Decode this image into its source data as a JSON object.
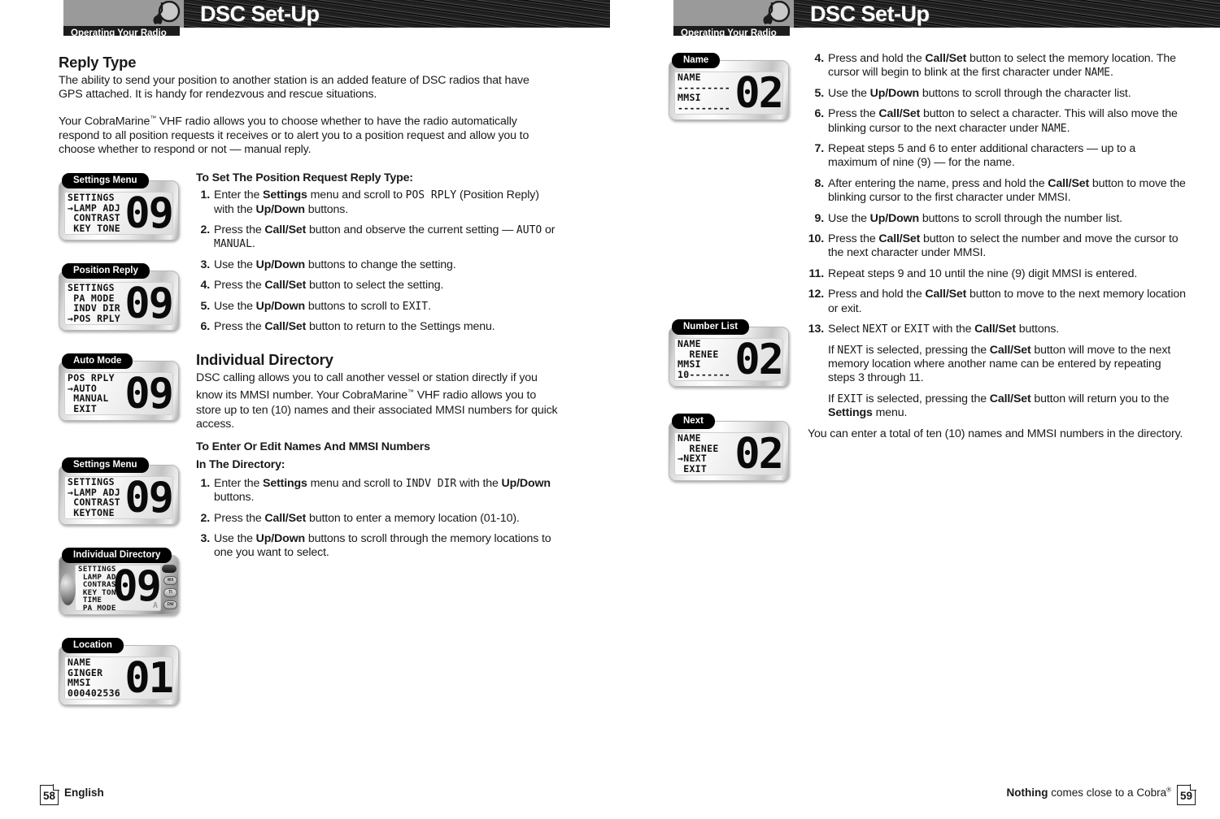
{
  "header": {
    "title": "DSC Set-Up",
    "tab": "Operating Your Radio",
    "mic_icon": "radio-mic-icon"
  },
  "left_page": {
    "section_title": "Reply Type",
    "para1": "The ability to send your position to another station is an added feature of DSC radios that have GPS attached. It is handy for rendezvous and rescue situations.",
    "para2_a": "Your CobraMarine",
    "para2_tm": "™",
    "para2_b": " VHF radio allows you to choose whether to have the radio automatically respond to all position requests it receives or to alert you to a position request and allow you to choose whether to respond or not — manual reply.",
    "proc1_title": "To Set The Position Request Reply Type:",
    "proc1_steps": [
      {
        "num": "1.",
        "html": "Enter the <b>Settings</b> menu and scroll to <span class=\"lcdtxt\">POS RPLY</span> (Position Reply) with the <b>Up/Down</b> buttons."
      },
      {
        "num": "2.",
        "html": "Press the <b>Call/Set</b> button and observe the current setting — <span class=\"lcdtxt\">AUTO</span> or <span class=\"lcdtxt\">MANUAL</span>."
      },
      {
        "num": "3.",
        "html": "Use the <b>Up/Down</b> buttons to change the setting."
      },
      {
        "num": "4.",
        "html": "Press the <b>Call/Set</b> button to select the setting."
      },
      {
        "num": "5.",
        "html": "Use the <b>Up/Down</b> buttons to scroll to <span class=\"lcdtxt\">EXIT</span>."
      },
      {
        "num": "6.",
        "html": "Press the <b>Call/Set</b> button to return to the Settings menu."
      }
    ],
    "section2_title": "Individual Directory",
    "para3_a": "DSC calling allows you to call another vessel or station directly if you know its MMSI number. Your CobraMarine",
    "para3_tm": "™",
    "para3_b": " VHF radio allows you to store up to ten (10) names and their associated MMSI numbers for quick access.",
    "proc2_title_l1": "To Enter Or Edit Names And MMSI Numbers",
    "proc2_title_l2": "In The Directory:",
    "proc2_steps": [
      {
        "num": "1.",
        "html": "Enter the <b>Settings</b> menu and scroll to <span class=\"lcdtxt\">INDV DIR</span> with the <b>Up/Down</b> buttons."
      },
      {
        "num": "2.",
        "html": "Press the <b>Call/Set</b> button to enter a memory location (01-10)."
      },
      {
        "num": "3.",
        "html": "Use the <b>Up/Down</b> buttons to scroll through the memory locations to one you want to select."
      }
    ],
    "figures": [
      {
        "caption": "Settings Menu",
        "lines": "SETTINGS\n→LAMP ADJ\n CONTRAST\n KEY TONE",
        "number": "09",
        "style": "lcd"
      },
      {
        "caption": "Position Reply",
        "lines": "SETTINGS\n PA MODE\n INDV DIR\n→POS RPLY",
        "number": "09",
        "style": "lcd"
      },
      {
        "caption": "Auto Mode",
        "lines": "POS RPLY\n→AUTO\n MANUAL\n EXIT",
        "number": "09",
        "style": "lcd"
      },
      {
        "caption": "Settings Menu",
        "lines": "SETTINGS\n→LAMP ADJ\n CONTRAST\n KEYTONE",
        "number": "09",
        "style": "lcd"
      },
      {
        "caption": "Individual Directory",
        "lines": "SETTINGS\n LAMP ADJ\n CONTRAST\n KEY TONE\n TIME\n PA MODE\n→INDV DIR",
        "number": "09",
        "style": "photo",
        "dim": "A",
        "buttons": [
          "WX",
          "TI",
          "DW"
        ]
      },
      {
        "caption": "Location",
        "lines": "NAME\nGINGER\nMMSI\n000402536",
        "number": "01",
        "style": "lcd"
      }
    ],
    "footer": {
      "page": "58",
      "label": "English"
    }
  },
  "right_page": {
    "steps": [
      {
        "num": "4.",
        "html": "Press and hold the <b>Call/Set</b> button to select the memory location. The cursor will begin to blink at the first character under <span class=\"lcdtxt\">NAME</span>."
      },
      {
        "num": "5.",
        "html": "Use the <b>Up/Down</b> buttons to scroll through the character list."
      },
      {
        "num": "6.",
        "html": "Press the <b>Call/Set</b> button to select a character. This will also move the blinking cursor to the next character under <span class=\"lcdtxt\">NAME</span>."
      },
      {
        "num": "7.",
        "html": "Repeat steps 5 and 6 to enter additional characters — up to a maximum of nine (9) — for the name."
      },
      {
        "num": "8.",
        "html": "After entering the name, press and hold the <b>Call/Set</b> button to move the blinking cursor to the first character under MMSI."
      },
      {
        "num": "9.",
        "html": "Use the <b>Up/Down</b> buttons to scroll through the number list."
      },
      {
        "num": "10.",
        "html": "Press the <b>Call/Set</b> button to select the number and move the cursor to the next character under MMSI."
      },
      {
        "num": "11.",
        "html": "Repeat steps 9 and 10 until the nine (9) digit MMSI is entered."
      },
      {
        "num": "12.",
        "html": "Press and hold the <b>Call/Set</b> button to move to the next memory location or exit."
      },
      {
        "num": "13.",
        "html": "Select <span class=\"lcdtxt\">NEXT</span> or <span class=\"lcdtxt\">EXIT</span> with the <b>Call/Set</b> buttons."
      }
    ],
    "cont1": "If <span class=\"lcdtxt\">NEXT</span> is selected, pressing the <b>Call/Set</b> button will move to the next memory location where another name can be entered by repeating steps 3 through 11.",
    "cont2": "If <span class=\"lcdtxt\">EXIT</span> is selected, pressing the <b>Call/Set</b> button will return you to the <b>Settings</b> menu.",
    "cont3": "You can enter a total of ten (10) names and MMSI numbers in the directory.",
    "figures": [
      {
        "caption": "Name",
        "lines": "NAME\n---------\nMMSI\n---------",
        "number": "02",
        "style": "lcd"
      },
      {
        "caption": "Number List",
        "lines": "NAME\n  RENEE\nMMSI\n10-------",
        "number": "02",
        "style": "lcd"
      },
      {
        "caption": "Next",
        "lines": "NAME\n  RENEE\n→NEXT\n EXIT",
        "number": "02",
        "style": "lcd"
      }
    ],
    "footer": {
      "page": "59",
      "tag_bold": "Nothing",
      "tag_rest": " comes close to a Cobra",
      "tag_sup": "®"
    }
  },
  "colors": {
    "header_grey": "#9a9a9a",
    "header_black": "#1c1c1c",
    "text": "#1a1a1a",
    "white": "#ffffff"
  }
}
